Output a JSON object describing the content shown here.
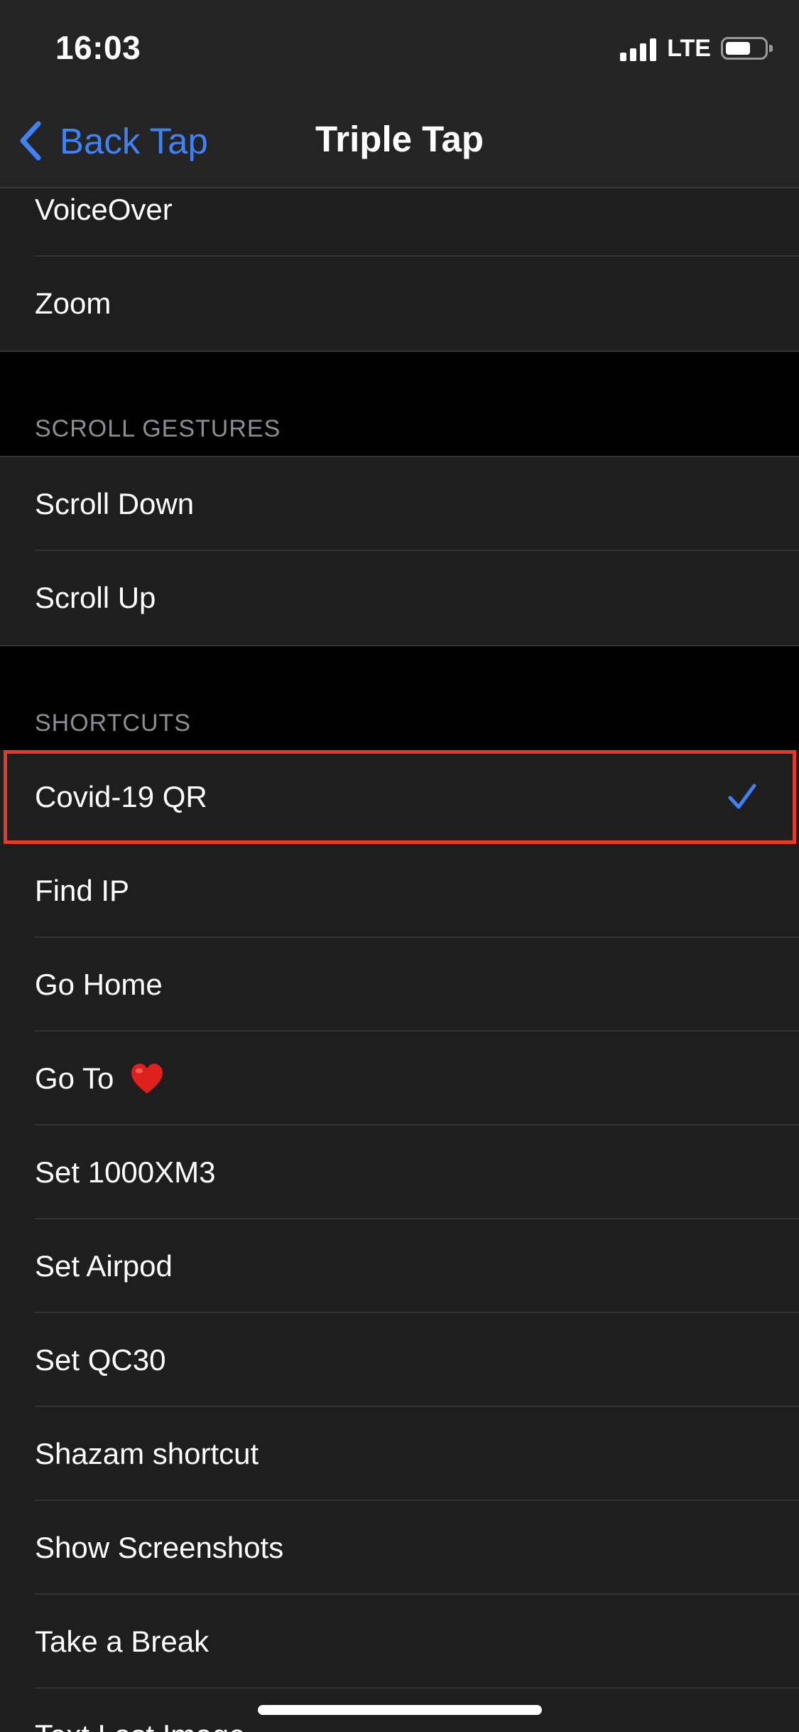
{
  "status_bar": {
    "time": "16:03",
    "network": "LTE"
  },
  "nav": {
    "back_label": "Back Tap",
    "title": "Triple Tap"
  },
  "top_items": [
    {
      "label": "VoiceOver"
    },
    {
      "label": "Zoom"
    }
  ],
  "scroll_gestures": {
    "header": "SCROLL GESTURES",
    "items": [
      {
        "label": "Scroll Down"
      },
      {
        "label": "Scroll Up"
      }
    ]
  },
  "shortcuts": {
    "header": "SHORTCUTS",
    "selected_index": 0,
    "items": [
      {
        "label": "Covid-19 QR",
        "checked": true
      },
      {
        "label": "Find IP"
      },
      {
        "label": "Go Home"
      },
      {
        "label": "Go To",
        "emoji": "red-heart-icon"
      },
      {
        "label": "Set 1000XM3"
      },
      {
        "label": "Set Airpod"
      },
      {
        "label": "Set QC30"
      },
      {
        "label": "Shazam shortcut"
      },
      {
        "label": "Show Screenshots"
      },
      {
        "label": "Take a Break"
      },
      {
        "label": "Text Last Image"
      }
    ]
  },
  "colors": {
    "accent": "#3f82f6",
    "highlight": "#e23b2a",
    "row_background": "#1e1e1e",
    "header_text": "#8d8d93"
  }
}
